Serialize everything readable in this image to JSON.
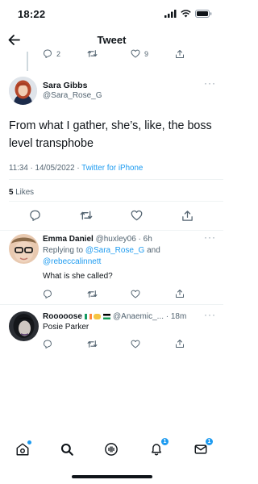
{
  "status_bar": {
    "time": "18:22"
  },
  "nav": {
    "title": "Tweet"
  },
  "parent_tweet": {
    "reply_count": "2",
    "like_count": "9"
  },
  "main_tweet": {
    "author_name": "Sara Gibbs",
    "author_handle": "@Sara_Rose_G",
    "text": "From what I gather, she’s, like, the boss level transphobe",
    "time": "11:34",
    "date": "14/05/2022",
    "separator": "·",
    "source": "Twitter for iPhone",
    "likes_count": "5",
    "likes_label": "Likes"
  },
  "replies": [
    {
      "name": "Emma Daniel",
      "handle": "@huxley06",
      "time": "6h",
      "replying_prefix": "Replying to",
      "mention_1": "@Sara_Rose_G",
      "and_word": "and",
      "mention_2": "@rebeccalinnett",
      "text": "What is she called?"
    },
    {
      "name": "Rooooose",
      "handle": "@Anaemic_...",
      "time": "18m",
      "text": "Posie Parker"
    }
  ],
  "tab_bar": {
    "notifications_badge": "1",
    "messages_badge": "1"
  },
  "colors": {
    "accent": "#1d9bf0",
    "text": "#0f1419",
    "secondary": "#536471",
    "divider": "#eff3f4"
  }
}
